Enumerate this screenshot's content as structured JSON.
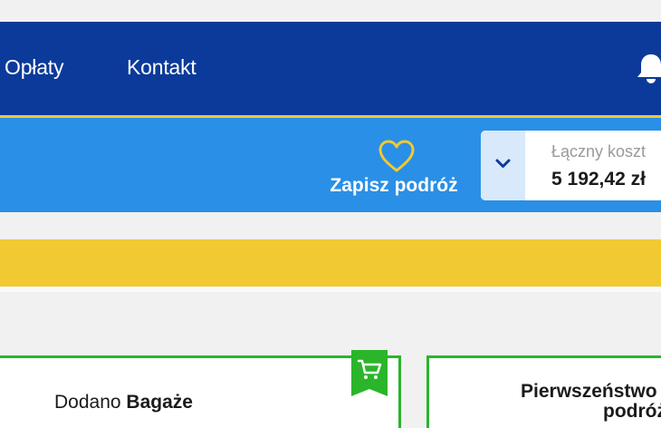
{
  "nav": {
    "links": [
      {
        "label": "Opłaty"
      },
      {
        "label": "Kontakt"
      }
    ],
    "notification_icon": "bell-icon"
  },
  "subbar": {
    "save_trip_label": "Zapisz podróż",
    "save_trip_icon": "heart-icon",
    "cost": {
      "label": "Łączny koszt",
      "value": "5 192,42 zł",
      "toggle_icon": "chevron-down-icon"
    }
  },
  "cards": {
    "baggage": {
      "prefix": "Dodano",
      "title": "Bagaże",
      "badge_icon": "cart-icon"
    },
    "priority": {
      "title": "Pierwszeństwo",
      "subtitle": "podróż"
    }
  },
  "colors": {
    "navbar": "#0c3a9a",
    "subbar": "#2a8fe6",
    "accent_yellow": "#f1c933",
    "card_border_green": "#2bb52b"
  }
}
